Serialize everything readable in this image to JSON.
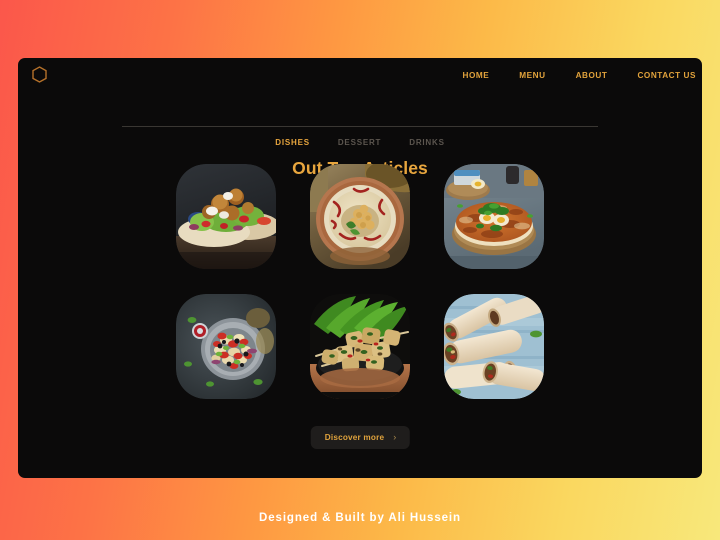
{
  "theme": {
    "gradient_start": "#fb574b",
    "gradient_mid": "#fe9842",
    "gradient_end": "#f8e87b",
    "panel_bg": "#0b0a0a",
    "accent_gold": "#e8a63e",
    "muted_text": "#5c564f",
    "divider": "#3a3733",
    "button_bg": "#1f1d1c",
    "footer_text": "#ffffff"
  },
  "header": {
    "logo_icon": "hexagon-outline-icon",
    "nav": [
      {
        "label": "HOME"
      },
      {
        "label": "MENU"
      },
      {
        "label": "ABOUT"
      },
      {
        "label": "CONTACT US"
      }
    ]
  },
  "main": {
    "title": "Out Top Articles",
    "tabs": [
      {
        "label": "DISHES",
        "active": true
      },
      {
        "label": "DESSERT",
        "active": false
      },
      {
        "label": "DRINKS",
        "active": false
      }
    ],
    "cards": [
      {
        "name": "falafel-wrap-salad"
      },
      {
        "name": "hummus-bowl"
      },
      {
        "name": "lahmacun-flatbread"
      },
      {
        "name": "mediterranean-salad-bowl"
      },
      {
        "name": "grilled-skewers-pan"
      },
      {
        "name": "shawarma-wraps"
      }
    ],
    "discover_button": {
      "label": "Discover more",
      "chevron": "›"
    }
  },
  "footer": {
    "credit": "Designed & Built by Ali Hussein"
  }
}
